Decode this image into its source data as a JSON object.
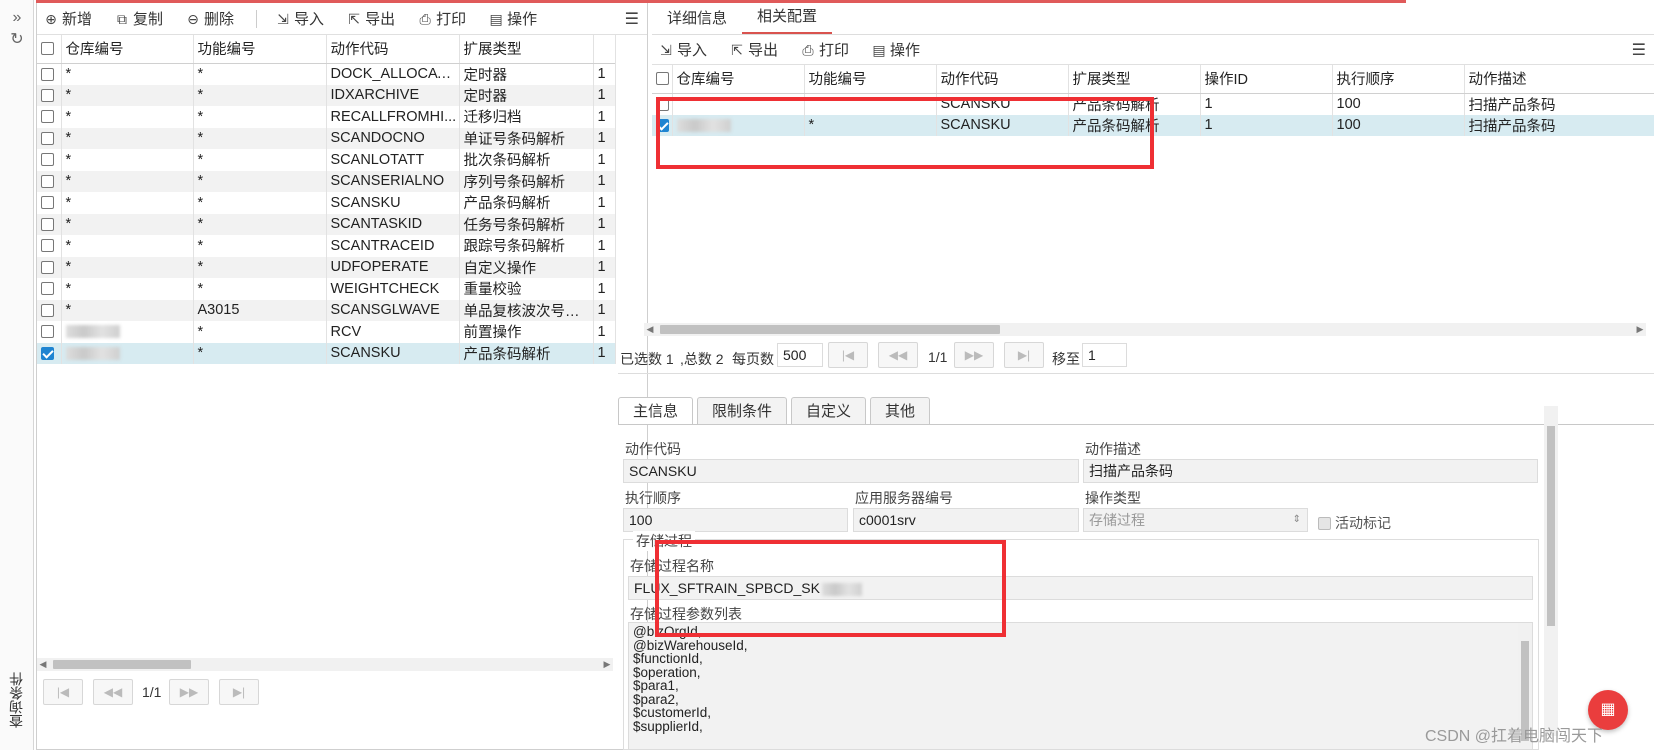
{
  "rail": {
    "expand_icon": "double-chevron-right-icon",
    "refresh_icon": "refresh-icon",
    "query_label": "查询条件"
  },
  "left": {
    "toolbar": [
      {
        "label": "新增",
        "icon": "plus-circle-icon",
        "glyph": "⊕"
      },
      {
        "label": "复制",
        "icon": "copy-icon",
        "glyph": "⧉"
      },
      {
        "label": "删除",
        "icon": "minus-circle-icon",
        "glyph": "⊖"
      },
      {
        "label": "导入",
        "icon": "import-icon",
        "glyph": "⇲"
      },
      {
        "label": "导出",
        "icon": "export-icon",
        "glyph": "⇱"
      },
      {
        "label": "打印",
        "icon": "print-icon",
        "glyph": "⎙"
      },
      {
        "label": "操作",
        "icon": "operation-icon",
        "glyph": "▤"
      }
    ],
    "columns": [
      "仓库编号",
      "功能编号",
      "动作代码",
      "扩展类型",
      ""
    ],
    "rows": [
      {
        "wh": "*",
        "fn": "*",
        "code": "DOCK_ALLOCATI...",
        "type": "定时器",
        "n": "1",
        "checked": false,
        "blur": false
      },
      {
        "wh": "*",
        "fn": "*",
        "code": "IDXARCHIVE",
        "type": "定时器",
        "n": "1",
        "checked": false,
        "blur": false
      },
      {
        "wh": "*",
        "fn": "*",
        "code": "RECALLFROMHI...",
        "type": "迁移归档",
        "n": "1",
        "checked": false,
        "blur": false
      },
      {
        "wh": "*",
        "fn": "*",
        "code": "SCANDOCNO",
        "type": "单证号条码解析",
        "n": "1",
        "checked": false,
        "blur": false
      },
      {
        "wh": "*",
        "fn": "*",
        "code": "SCANLOTATT",
        "type": "批次条码解析",
        "n": "1",
        "checked": false,
        "blur": false
      },
      {
        "wh": "*",
        "fn": "*",
        "code": "SCANSERIALNO",
        "type": "序列号条码解析",
        "n": "1",
        "checked": false,
        "blur": false
      },
      {
        "wh": "*",
        "fn": "*",
        "code": "SCANSKU",
        "type": "产品条码解析",
        "n": "1",
        "checked": false,
        "blur": false
      },
      {
        "wh": "*",
        "fn": "*",
        "code": "SCANTASKID",
        "type": "任务号条码解析",
        "n": "1",
        "checked": false,
        "blur": false
      },
      {
        "wh": "*",
        "fn": "*",
        "code": "SCANTRACEID",
        "type": "跟踪号条码解析",
        "n": "1",
        "checked": false,
        "blur": false
      },
      {
        "wh": "*",
        "fn": "*",
        "code": "UDFOPERATE",
        "type": "自定义操作",
        "n": "1",
        "checked": false,
        "blur": false
      },
      {
        "wh": "*",
        "fn": "*",
        "code": "WEIGHTCHECK",
        "type": "重量校验",
        "n": "1",
        "checked": false,
        "blur": false
      },
      {
        "wh": "*",
        "fn": "A3015",
        "code": "SCANSGLWAVE",
        "type": "单品复核波次号解析",
        "n": "1",
        "checked": false,
        "blur": false
      },
      {
        "wh": "",
        "fn": "*",
        "code": "RCV",
        "type": "前置操作",
        "n": "1",
        "checked": false,
        "blur": true
      },
      {
        "wh": "",
        "fn": "*",
        "code": "SCANSKU",
        "type": "产品条码解析",
        "n": "1",
        "checked": true,
        "blur": true
      }
    ],
    "pager": {
      "page": "1/1"
    }
  },
  "right": {
    "tabs": [
      "详细信息",
      "相关配置"
    ],
    "active_tab": 1,
    "toolbar": [
      {
        "label": "导入",
        "icon": "import-icon",
        "glyph": "⇲"
      },
      {
        "label": "导出",
        "icon": "export-icon",
        "glyph": "⇱"
      },
      {
        "label": "打印",
        "icon": "print-icon",
        "glyph": "⎙"
      },
      {
        "label": "操作",
        "icon": "operation-icon",
        "glyph": "▤"
      }
    ],
    "columns": [
      "仓库编号",
      "功能编号",
      "动作代码",
      "扩展类型",
      "操作ID",
      "执行顺序",
      "动作描述"
    ],
    "rows": [
      {
        "wh": "",
        "fn": "",
        "code": "SCANSKU",
        "type": "产品条码解析",
        "op": "1",
        "order": "100",
        "desc": "扫描产品条码",
        "checked": false,
        "blur": false
      },
      {
        "wh": "",
        "fn": "*",
        "code": "SCANSKU",
        "type": "产品条码解析",
        "op": "1",
        "order": "100",
        "desc": "扫描产品条码",
        "checked": true,
        "blur": true
      }
    ],
    "pager": {
      "selected": "已选数 1",
      "total": ",总数 2",
      "per_page_label": "每页数",
      "per_page": "500",
      "page": "1/1",
      "goto_label": "移至",
      "goto_value": "1"
    },
    "detail_tabs": [
      "主信息",
      "限制条件",
      "自定义",
      "其他"
    ],
    "form": {
      "action_code_label": "动作代码",
      "action_code": "SCANSKU",
      "action_desc_label": "动作描述",
      "action_desc": "扫描产品条码",
      "order_label": "执行顺序",
      "order": "100",
      "server_label": "应用服务器编号",
      "server": "c0001srv",
      "op_type_label": "操作类型",
      "op_type": "存储过程",
      "active_label": "活动标记",
      "proc_group": "存储过程",
      "proc_name_label": "存储过程名称",
      "proc_name": "FLUX_SFTRAIN_SPBCD_SK",
      "params_label": "存储过程参数列表",
      "params": [
        "@bizOrgId,",
        "@bizWarehouseId,",
        "$functionId,",
        "$operation,",
        "$para1,",
        "$para2,",
        "$customerId,",
        "$supplierId,"
      ]
    }
  },
  "watermark": "CSDN @扛着电脑闯天下",
  "fab_icon": "grid-icon"
}
